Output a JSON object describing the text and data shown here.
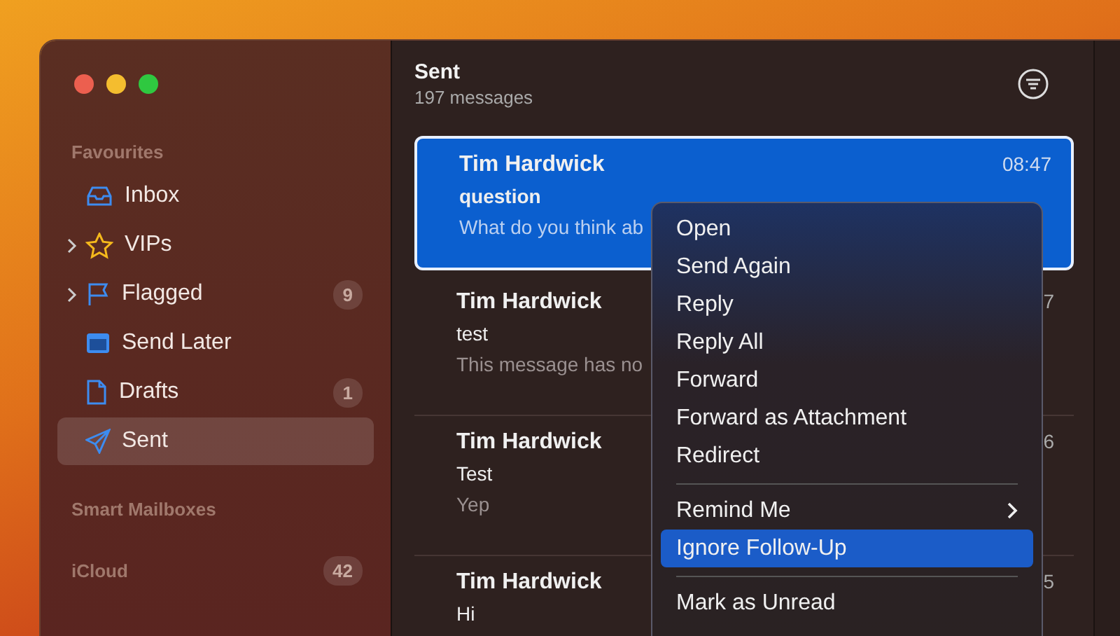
{
  "sidebar": {
    "sections": [
      {
        "title": "Favourites",
        "items": [
          {
            "label": "Inbox",
            "expandable": false,
            "selected": false
          },
          {
            "label": "VIPs",
            "expandable": true,
            "selected": false
          },
          {
            "label": "Flagged",
            "expandable": true,
            "count": "9",
            "selected": false
          },
          {
            "label": "Send Later",
            "expandable": false,
            "selected": false
          },
          {
            "label": "Drafts",
            "expandable": false,
            "count": "1",
            "selected": false
          },
          {
            "label": "Sent",
            "expandable": false,
            "selected": true
          }
        ]
      },
      {
        "title": "Smart Mailboxes"
      },
      {
        "title": "iCloud",
        "count": "42"
      }
    ]
  },
  "message_list": {
    "title": "Sent",
    "subtitle": "197 messages",
    "messages": [
      {
        "sender": "Tim Hardwick",
        "time": "08:47",
        "subject": "question",
        "preview": "What do you think ab",
        "selected": true
      },
      {
        "sender": "Tim Hardwick",
        "time": "7",
        "subject": "test",
        "preview": "This message has no",
        "selected": false
      },
      {
        "sender": "Tim Hardwick",
        "time": "6",
        "subject": "Test",
        "preview": "Yep",
        "selected": false
      },
      {
        "sender": "Tim Hardwick",
        "time": "5",
        "subject": "Hi",
        "selected": false
      }
    ]
  },
  "context_menu": {
    "items": [
      {
        "kind": "item",
        "label": "Open",
        "selected": false
      },
      {
        "kind": "item",
        "label": "Send Again",
        "selected": false
      },
      {
        "kind": "item",
        "label": "Reply",
        "selected": false
      },
      {
        "kind": "item",
        "label": "Reply All",
        "selected": false
      },
      {
        "kind": "item",
        "label": "Forward",
        "selected": false
      },
      {
        "kind": "item",
        "label": "Forward as Attachment",
        "selected": false
      },
      {
        "kind": "item",
        "label": "Redirect",
        "selected": false
      },
      {
        "kind": "separator"
      },
      {
        "kind": "submenu",
        "label": "Remind Me",
        "selected": false
      },
      {
        "kind": "item",
        "label": "Ignore Follow-Up",
        "selected": true
      },
      {
        "kind": "separator"
      },
      {
        "kind": "item",
        "label": "Mark as Unread",
        "selected": false
      }
    ]
  }
}
